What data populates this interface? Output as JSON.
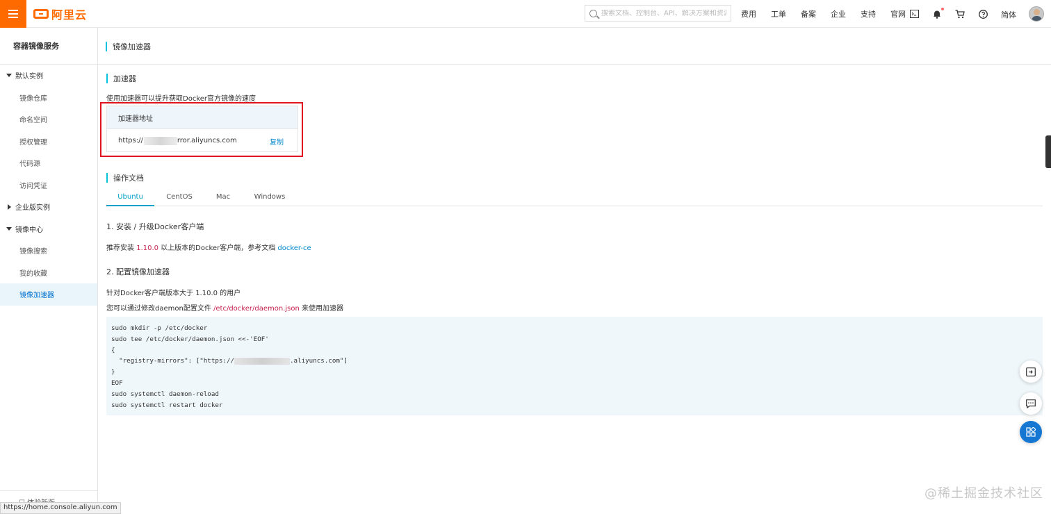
{
  "topbar": {
    "logo_text": "阿里云",
    "search_placeholder": "搜索文档、控制台、API、解决方案和资源",
    "nav_links": [
      "费用",
      "工单",
      "备案",
      "企业",
      "支持",
      "官网"
    ],
    "lang": "简体",
    "brand_color": "#ff6a00"
  },
  "sidebar": {
    "title": "容器镜像服务",
    "groups": [
      {
        "label": "默认实例",
        "expanded": true,
        "items": [
          "镜像仓库",
          "命名空间",
          "授权管理",
          "代码源",
          "访问凭证"
        ]
      },
      {
        "label": "企业版实例",
        "expanded": false,
        "items": []
      },
      {
        "label": "镜像中心",
        "expanded": true,
        "items": [
          "镜像搜索",
          "我的收藏",
          "镜像加速器"
        ]
      }
    ],
    "active_item": "镜像加速器",
    "footer": "体验新版"
  },
  "status_url": "https://home.console.aliyun.com",
  "main": {
    "page_title": "镜像加速器",
    "accelerator": {
      "section_title": "加速器",
      "description": "使用加速器可以提升获取Docker官方镜像的速度",
      "table_header": "加速器地址",
      "address_prefix": "https://",
      "address_suffix": "rror.aliyuncs.com",
      "copy_label": "复制"
    },
    "docs": {
      "section_title": "操作文档",
      "tabs": [
        "Ubuntu",
        "CentOS",
        "Mac",
        "Windows"
      ],
      "active_tab": "Ubuntu",
      "step1_title": "1. 安装 / 升级Docker客户端",
      "step1_text_pre": "推荐安装 ",
      "step1_version": "1.10.0",
      "step1_text_mid": " 以上版本的Docker客户端，参考文档 ",
      "step1_link": "docker-ce",
      "step2_title": "2. 配置镜像加速器",
      "step2_line1": "针对Docker客户端版本大于 1.10.0 的用户",
      "step2_line2_pre": "您可以通过修改daemon配置文件 ",
      "step2_path": "/etc/docker/daemon.json",
      "step2_line2_post": " 来使用加速器",
      "code_lines": [
        "sudo mkdir -p /etc/docker",
        "sudo tee /etc/docker/daemon.json <<-'EOF'",
        "{",
        "  \"registry-mirrors\": [\"https://",
        "}",
        "EOF",
        "sudo systemctl daemon-reload",
        "sudo systemctl restart docker"
      ],
      "code_mirror_suffix": ".aliyuncs.com\"]"
    }
  },
  "accent_color": "#00c1de",
  "watermark": "@稀土掘金技术社区"
}
